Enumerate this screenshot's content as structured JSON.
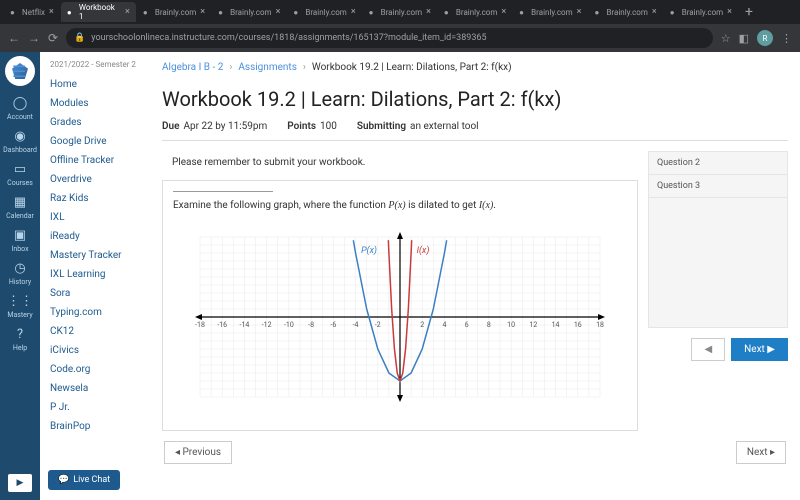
{
  "tabs": [
    {
      "label": "Netflix",
      "active": false
    },
    {
      "label": "Workbook 1",
      "active": true
    },
    {
      "label": "Brainly.com",
      "active": false
    },
    {
      "label": "Brainly.com",
      "active": false
    },
    {
      "label": "Brainly.com",
      "active": false
    },
    {
      "label": "Brainly.com",
      "active": false
    },
    {
      "label": "Brainly.com",
      "active": false
    },
    {
      "label": "Brainly.com",
      "active": false
    },
    {
      "label": "Brainly.com",
      "active": false
    },
    {
      "label": "Brainly.com",
      "active": false
    }
  ],
  "url": "yourschoolonlineca.instructure.com/courses/1818/assignments/165137?module_item_id=389365",
  "avatar": "R",
  "rail": [
    {
      "label": "Account",
      "icon": "user"
    },
    {
      "label": "Dashboard",
      "icon": "gauge"
    },
    {
      "label": "Courses",
      "icon": "book"
    },
    {
      "label": "Calendar",
      "icon": "calendar"
    },
    {
      "label": "Inbox",
      "icon": "inbox"
    },
    {
      "label": "History",
      "icon": "clock"
    },
    {
      "label": "Mastery",
      "icon": "dots"
    },
    {
      "label": "Help",
      "icon": "help"
    }
  ],
  "term": "2021/2022 - Semester 2",
  "sidelinks": [
    "Home",
    "Modules",
    "Grades",
    "Google Drive",
    "Offline Tracker",
    "Overdrive",
    "Raz Kids",
    "IXL",
    "iReady",
    "Mastery Tracker",
    "IXL Learning",
    "Sora",
    "Typing.com",
    "CK12",
    "iCivics",
    "Code.org",
    "Newsela",
    "P Jr.",
    "BrainPop"
  ],
  "livechat": "Live Chat",
  "crumbs": {
    "c1": "Algebra I B - 2",
    "c2": "Assignments",
    "c3": "Workbook 19.2 | Learn: Dilations, Part 2: f(kx)"
  },
  "title": "Workbook 19.2 | Learn: Dilations, Part 2: f(kx)",
  "meta": {
    "dueLabel": "Due",
    "due": "Apr 22 by 11:59pm",
    "pointsLabel": "Points",
    "points": "100",
    "submitLabel": "Submitting",
    "submit": "an external tool"
  },
  "reminder": "Please remember to submit your workbook.",
  "question": {
    "prefix": "Examine the following graph, where the function ",
    "p": "P(x)",
    "mid": " is dilated to get ",
    "i": "I(x)",
    "suffix": "."
  },
  "qlist": [
    "Question 2",
    "Question 3"
  ],
  "qnav": {
    "prev": "◀",
    "next": "Next ▶"
  },
  "bottom": {
    "prev": "◂ Previous",
    "next": "Next ▸"
  },
  "chart_data": {
    "type": "line",
    "xlim": [
      -18,
      18
    ],
    "ylim": [
      -10,
      10
    ],
    "xticks": [
      -18,
      -16,
      -14,
      -12,
      -10,
      -8,
      -6,
      -4,
      -2,
      0,
      2,
      4,
      6,
      8,
      10,
      12,
      14,
      16,
      18
    ],
    "series": [
      {
        "name": "P(x)",
        "color": "#3b7fc4",
        "formula": "x^2 - 8",
        "points": [
          [
            -4.2,
            9.6
          ],
          [
            -4,
            8
          ],
          [
            -3,
            1
          ],
          [
            -2,
            -4
          ],
          [
            -1,
            -7
          ],
          [
            0,
            -8
          ],
          [
            1,
            -7
          ],
          [
            2,
            -4
          ],
          [
            3,
            1
          ],
          [
            4,
            8
          ],
          [
            4.2,
            9.6
          ]
        ]
      },
      {
        "name": "I(x)",
        "color": "#c73b3b",
        "formula": "(4x)^2 - 8",
        "points": [
          [
            -1.05,
            9.6
          ],
          [
            -1,
            8
          ],
          [
            -0.75,
            1
          ],
          [
            -0.5,
            -4
          ],
          [
            -0.25,
            -7
          ],
          [
            0,
            -8
          ],
          [
            0.25,
            -7
          ],
          [
            0.5,
            -4
          ],
          [
            0.75,
            1
          ],
          [
            1,
            8
          ],
          [
            1.05,
            9.6
          ]
        ]
      }
    ],
    "labels": {
      "P": "P(x)",
      "I": "I(x)"
    }
  }
}
